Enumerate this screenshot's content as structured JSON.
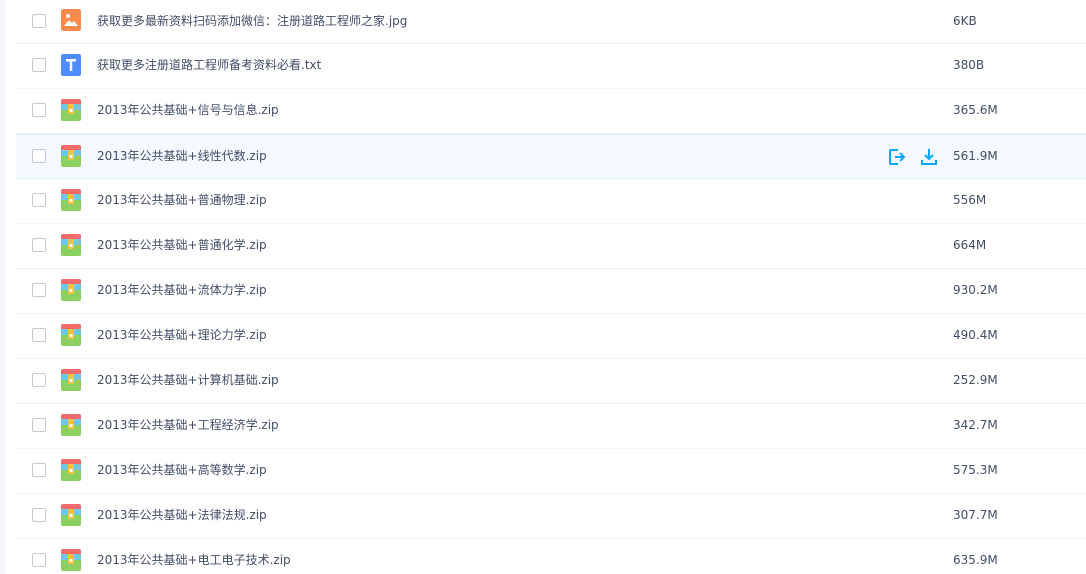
{
  "colors": {
    "text": "#424e67",
    "accent": "#06a7ff",
    "image_icon": "#f98a4b",
    "text_icon": "#4e8cff",
    "zip_top": "#f56b6b",
    "zip_left": "#6cc8f0",
    "zip_right": "#8ad160",
    "zip_bottom": "#f7c244",
    "hover_bg": "#f4faff"
  },
  "files": [
    {
      "name": "获取更多最新资料扫码添加微信：注册道路工程师之家.jpg",
      "size": "6KB",
      "icon": "image-file-icon"
    },
    {
      "name": "获取更多注册道路工程师备考资料必看.txt",
      "size": "380B",
      "icon": "text-file-icon"
    },
    {
      "name": "2013年公共基础+信号与信息.zip",
      "size": "365.6M",
      "icon": "zip-file-icon"
    },
    {
      "name": "2013年公共基础+线性代数.zip",
      "size": "561.9M",
      "icon": "zip-file-icon"
    },
    {
      "name": "2013年公共基础+普通物理.zip",
      "size": "556M",
      "icon": "zip-file-icon"
    },
    {
      "name": "2013年公共基础+普通化学.zip",
      "size": "664M",
      "icon": "zip-file-icon"
    },
    {
      "name": "2013年公共基础+流体力学.zip",
      "size": "930.2M",
      "icon": "zip-file-icon"
    },
    {
      "name": "2013年公共基础+理论力学.zip",
      "size": "490.4M",
      "icon": "zip-file-icon"
    },
    {
      "name": "2013年公共基础+计算机基础.zip",
      "size": "252.9M",
      "icon": "zip-file-icon"
    },
    {
      "name": "2013年公共基础+工程经济学.zip",
      "size": "342.7M",
      "icon": "zip-file-icon"
    },
    {
      "name": "2013年公共基础+高等数学.zip",
      "size": "575.3M",
      "icon": "zip-file-icon"
    },
    {
      "name": "2013年公共基础+法律法规.zip",
      "size": "307.7M",
      "icon": "zip-file-icon"
    },
    {
      "name": "2013年公共基础+电工电子技术.zip",
      "size": "635.9M",
      "icon": "zip-file-icon"
    }
  ],
  "hovered_row_actions": {
    "share_icon": "share-icon",
    "download_icon": "download-icon"
  }
}
